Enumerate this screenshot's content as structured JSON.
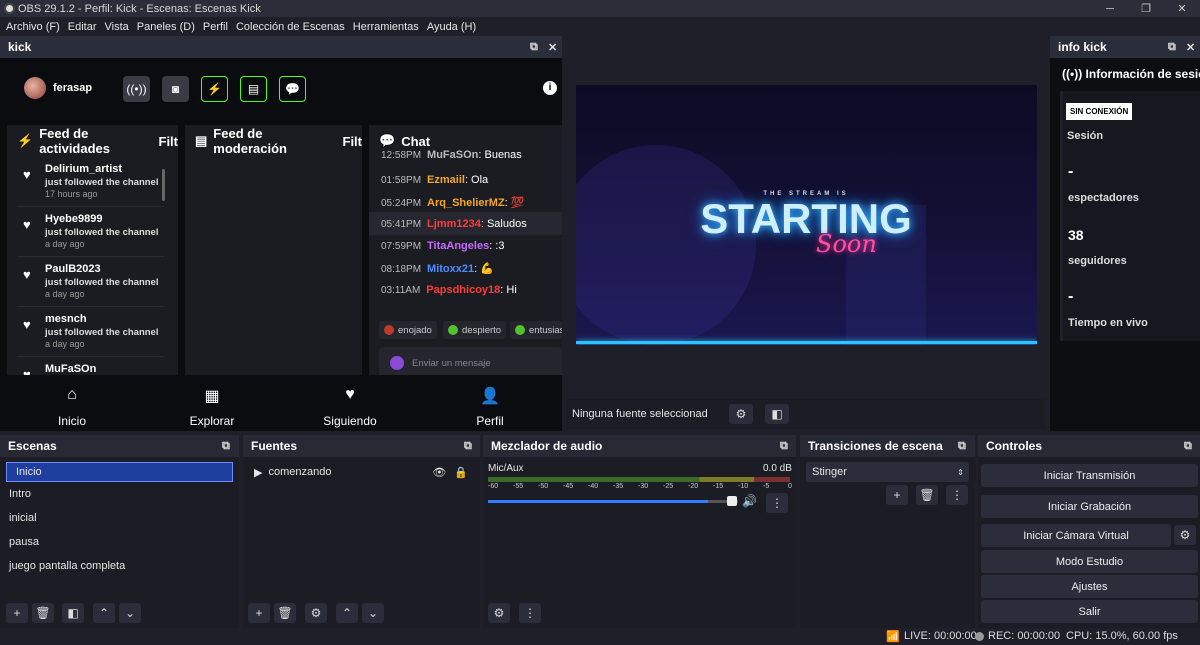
{
  "titlebar": {
    "title": "OBS 29.1.2 - Perfil: Kick - Escenas: Escenas Kick",
    "minimize": "─",
    "maximize": "❐",
    "close": "✕"
  },
  "menu": [
    "Archivo (F)",
    "Editar",
    "Vista",
    "Paneles (D)",
    "Perfil",
    "Colección de Escenas",
    "Herramientas",
    "Ayuda (H)"
  ],
  "kick": {
    "title": "kick",
    "user": "ferasap",
    "feed": {
      "title": "Feed de actividades",
      "filter": "Filt",
      "items": [
        {
          "name": "Delirium_artist",
          "desc": "just followed the channel",
          "ago": "17 hours ago"
        },
        {
          "name": "Hyebe9899",
          "desc": "just followed the channel",
          "ago": "a day ago"
        },
        {
          "name": "PaulB2023",
          "desc": "just followed the channel",
          "ago": "a day ago"
        },
        {
          "name": "mesnch",
          "desc": "just followed the channel",
          "ago": "a day ago"
        },
        {
          "name": "MuFaSOn",
          "desc": "",
          "ago": ""
        }
      ]
    },
    "moderation": {
      "title": "Feed de moderación",
      "filter": "Filt"
    },
    "chat": {
      "title": "Chat",
      "messages": [
        {
          "time": "12:58PM",
          "user": "MuFaSOn",
          "text": ": Buenas",
          "color": "#bbbbbb"
        },
        {
          "time": "01:58PM",
          "user": "Ezmaiil",
          "text": ": Ola",
          "color": "#f4a62a"
        },
        {
          "time": "05:24PM",
          "user": "Arq_ShelierMZ",
          "text": ": 💯",
          "color": "#f4a62a"
        },
        {
          "time": "05:41PM",
          "user": "Ljmm1234",
          "text": ": Saludos",
          "color": "#ff3b3b"
        },
        {
          "time": "07:59PM",
          "user": "TitaAngeles",
          "text": ": :3",
          "color": "#c86bff"
        },
        {
          "time": "08:18PM",
          "user": "Mitoxx21",
          "text": ": 💪",
          "color": "#4a8cff"
        },
        {
          "time": "03:11AM",
          "user": "Papsdhicoy18",
          "text": ": Hi",
          "color": "#ff3b3b"
        }
      ],
      "emotes": [
        "enojado",
        "despierto",
        "entusias"
      ],
      "placeholder": "Enviar un mensaje"
    },
    "nav": [
      "Inicio",
      "Explorar",
      "Siguiendo",
      "Perfil"
    ]
  },
  "preview": {
    "status": "Ninguna fuente seleccionad",
    "stream_top": "THE STREAM IS",
    "stream_main": "STARTING",
    "stream_script": "Soon"
  },
  "info": {
    "title": "info kick",
    "heading": "Información de sesión",
    "badge": "SIN CONEXIÓN",
    "session": "Sesión",
    "viewers_val": "-",
    "viewers": "espectadores",
    "followers_val": "38",
    "followers": "seguidores",
    "live_val": "-",
    "live": "Tiempo en vivo"
  },
  "scenes": {
    "title": "Escenas",
    "items": [
      "Inicio",
      "Intro",
      "inicial",
      "pausa",
      "juego pantalla completa"
    ]
  },
  "sources": {
    "title": "Fuentes",
    "items": [
      "comenzando"
    ]
  },
  "mixer": {
    "title": "Mezclador de audio",
    "channel": "Mic/Aux",
    "db": "0.0 dB",
    "ticks": [
      "-60",
      "-55",
      "-50",
      "-45",
      "-40",
      "-35",
      "-30",
      "-25",
      "-20",
      "-15",
      "-10",
      "-5",
      "0"
    ],
    "volume": 0.88
  },
  "transitions": {
    "title": "Transiciones de escena",
    "selected": "Stinger"
  },
  "controls": {
    "title": "Controles",
    "buttons": [
      "Iniciar Transmisión",
      "Iniciar Grabación",
      "Iniciar Cámara Virtual",
      "Modo Estudio",
      "Ajustes",
      "Salir"
    ]
  },
  "status": {
    "live": "LIVE: 00:00:00",
    "rec": "REC: 00:00:00",
    "cpu": "CPU: 15.0%, 60.00 fps"
  }
}
